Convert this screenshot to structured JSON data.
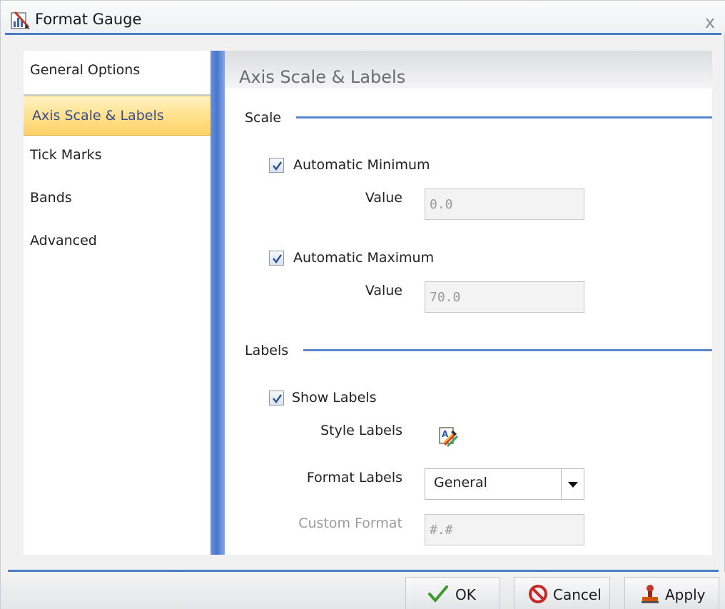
{
  "window": {
    "title": "Format Gauge",
    "close_glyph": "x"
  },
  "nav": {
    "items": [
      {
        "label": "General Options",
        "selected": false
      },
      {
        "label": "Axis Scale & Labels",
        "selected": true
      },
      {
        "label": "Tick Marks",
        "selected": false
      },
      {
        "label": "Bands",
        "selected": false
      },
      {
        "label": "Advanced",
        "selected": false
      }
    ]
  },
  "content": {
    "title": "Axis Scale & Labels",
    "scale": {
      "section_label": "Scale",
      "auto_min": {
        "label": "Automatic Minimum",
        "checked": true
      },
      "min_value": {
        "label": "Value",
        "value": "0.0"
      },
      "auto_max": {
        "label": "Automatic Maximum",
        "checked": true
      },
      "max_value": {
        "label": "Value",
        "value": "70.0"
      }
    },
    "labels": {
      "section_label": "Labels",
      "show_labels": {
        "label": "Show Labels",
        "checked": true
      },
      "style_labels": {
        "label": "Style Labels",
        "icon": "style-labels-icon"
      },
      "format_labels": {
        "label": "Format Labels",
        "selected": "General"
      },
      "custom_format": {
        "label": "Custom Format",
        "value": "#.#"
      }
    }
  },
  "buttons": {
    "ok": "OK",
    "cancel": "Cancel",
    "apply": "Apply"
  },
  "colors": {
    "accent": "#4a7bc7",
    "selected_nav": "#ffe08a"
  }
}
